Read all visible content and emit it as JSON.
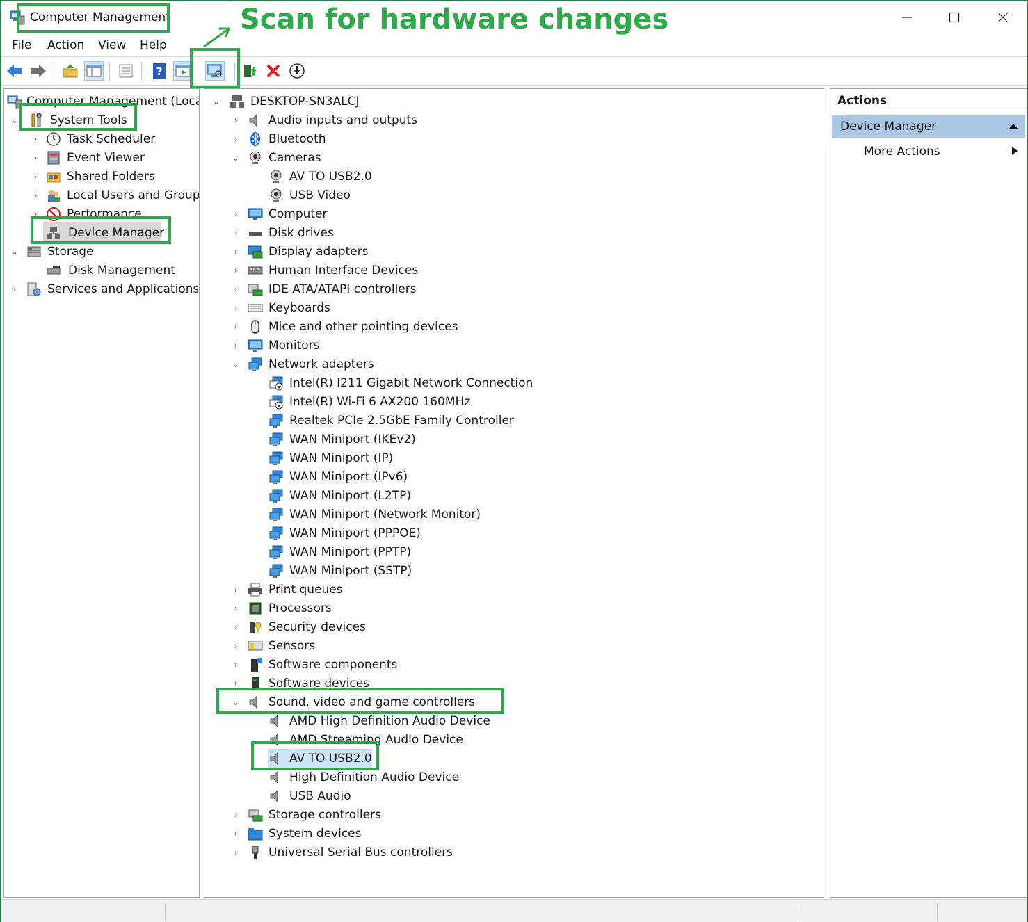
{
  "window": {
    "title": "Computer Management"
  },
  "annotation": {
    "text": "Scan for hardware changes"
  },
  "menu": [
    {
      "label": "File"
    },
    {
      "label": "Action"
    },
    {
      "label": "View"
    },
    {
      "label": "Help"
    }
  ],
  "left_tree": [
    {
      "label": "Computer Management (Local)",
      "icon": "computer-management-icon"
    },
    {
      "label": "System Tools",
      "icon": "system-tools-icon"
    },
    {
      "label": "Task Scheduler",
      "icon": "clock-icon"
    },
    {
      "label": "Event Viewer",
      "icon": "event-viewer-icon"
    },
    {
      "label": "Shared Folders",
      "icon": "shared-folder-icon"
    },
    {
      "label": "Local Users and Groups",
      "icon": "users-icon"
    },
    {
      "label": "Performance",
      "icon": "performance-icon"
    },
    {
      "label": "Device Manager",
      "icon": "device-manager-icon"
    },
    {
      "label": "Storage",
      "icon": "storage-icon"
    },
    {
      "label": "Disk Management",
      "icon": "disk-management-icon"
    },
    {
      "label": "Services and Applications",
      "icon": "services-icon"
    }
  ],
  "device_tree": {
    "root": "DESKTOP-SN3ALCJ",
    "items": [
      {
        "label": "Audio inputs and outputs",
        "icon": "speaker-icon"
      },
      {
        "label": "Bluetooth",
        "icon": "bluetooth-icon"
      },
      {
        "label": "Cameras",
        "icon": "camera-icon"
      },
      {
        "label": "AV TO USB2.0",
        "icon": "camera-icon"
      },
      {
        "label": "USB Video",
        "icon": "camera-icon"
      },
      {
        "label": "Computer",
        "icon": "monitor-icon"
      },
      {
        "label": "Disk drives",
        "icon": "disk-icon"
      },
      {
        "label": "Display adapters",
        "icon": "display-adapter-icon"
      },
      {
        "label": "Human Interface Devices",
        "icon": "hid-icon"
      },
      {
        "label": "IDE ATA/ATAPI controllers",
        "icon": "ide-icon"
      },
      {
        "label": "Keyboards",
        "icon": "keyboard-icon"
      },
      {
        "label": "Mice and other pointing devices",
        "icon": "mouse-icon"
      },
      {
        "label": "Monitors",
        "icon": "monitor-icon"
      },
      {
        "label": "Network adapters",
        "icon": "network-icon"
      },
      {
        "label": "Intel(R) I211 Gigabit Network Connection",
        "icon": "network-download-icon"
      },
      {
        "label": "Intel(R) Wi-Fi 6 AX200 160MHz",
        "icon": "network-download-icon"
      },
      {
        "label": "Realtek PCIe 2.5GbE Family Controller",
        "icon": "network-icon"
      },
      {
        "label": "WAN Miniport (IKEv2)",
        "icon": "network-icon"
      },
      {
        "label": "WAN Miniport (IP)",
        "icon": "network-icon"
      },
      {
        "label": "WAN Miniport (IPv6)",
        "icon": "network-icon"
      },
      {
        "label": "WAN Miniport (L2TP)",
        "icon": "network-icon"
      },
      {
        "label": "WAN Miniport (Network Monitor)",
        "icon": "network-icon"
      },
      {
        "label": "WAN Miniport (PPPOE)",
        "icon": "network-icon"
      },
      {
        "label": "WAN Miniport (PPTP)",
        "icon": "network-icon"
      },
      {
        "label": "WAN Miniport (SSTP)",
        "icon": "network-icon"
      },
      {
        "label": "Print queues",
        "icon": "printer-icon"
      },
      {
        "label": "Processors",
        "icon": "processor-icon"
      },
      {
        "label": "Security devices",
        "icon": "security-icon"
      },
      {
        "label": "Sensors",
        "icon": "sensor-icon"
      },
      {
        "label": "Software components",
        "icon": "software-component-icon"
      },
      {
        "label": "Software devices",
        "icon": "software-device-icon"
      },
      {
        "label": "Sound, video and game controllers",
        "icon": "speaker-icon"
      },
      {
        "label": "AMD High Definition Audio Device",
        "icon": "speaker-icon"
      },
      {
        "label": "AMD Streaming Audio Device",
        "icon": "speaker-icon"
      },
      {
        "label": "AV TO USB2.0",
        "icon": "speaker-icon"
      },
      {
        "label": "High Definition Audio Device",
        "icon": "speaker-icon"
      },
      {
        "label": "USB Audio",
        "icon": "speaker-icon"
      },
      {
        "label": "Storage controllers",
        "icon": "storage-controller-icon"
      },
      {
        "label": "System devices",
        "icon": "system-folder-icon"
      },
      {
        "label": "Universal Serial Bus controllers",
        "icon": "usb-icon"
      }
    ]
  },
  "actions": {
    "header": "Actions",
    "section": "Device Manager",
    "more": "More Actions"
  },
  "colors": {
    "annotation_green": "#2ea84a",
    "selection_gray": "#d9d9d9",
    "selection_blue": "#cce4f7",
    "actions_section": "#a9c6e4"
  }
}
